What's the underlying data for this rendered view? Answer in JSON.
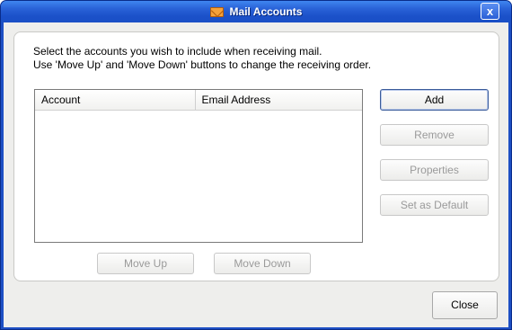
{
  "window": {
    "title": "Mail Accounts",
    "close_glyph": "x",
    "title_icon": "mail-icon"
  },
  "instructions": {
    "line1": "Select the accounts you wish to include when receiving mail.",
    "line2": "Use 'Move Up' and 'Move Down' buttons to change the receiving order."
  },
  "list": {
    "columns": [
      "Account",
      "Email Address"
    ],
    "rows": []
  },
  "side_buttons": {
    "add": "Add",
    "remove": "Remove",
    "properties": "Properties",
    "set_default": "Set as Default"
  },
  "order_buttons": {
    "move_up": "Move Up",
    "move_down": "Move Down"
  },
  "footer": {
    "close": "Close"
  }
}
